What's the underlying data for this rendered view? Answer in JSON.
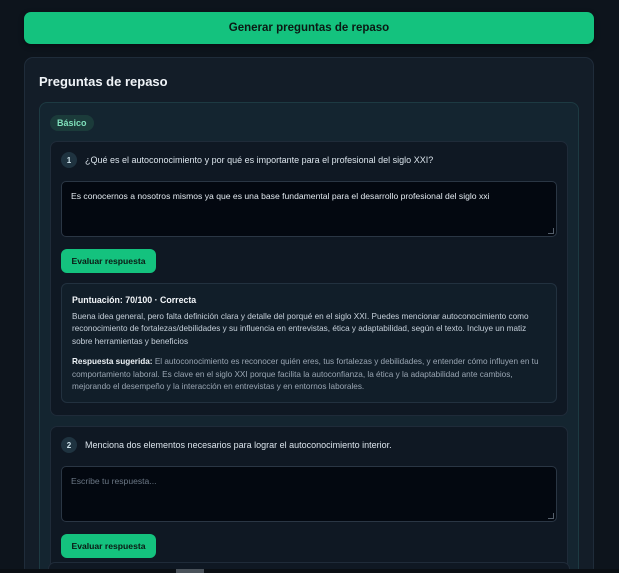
{
  "generate_button_label": "Generar preguntas de repaso",
  "review": {
    "title": "Preguntas de repaso",
    "level": "Básico",
    "questions": [
      {
        "number": "1",
        "text": "¿Qué es el autoconocimiento y por qué es importante para el profesional del siglo XXI?",
        "answer": "Es conocernos a nosotros mismos ya que es una base fundamental para el desarrollo profesional del siglo xxi",
        "eval_label": "Evaluar respuesta",
        "feedback": {
          "score": "Puntuación: 70/100 · Correcta",
          "text": "Buena idea general, pero falta definición clara y detalle del porqué en el siglo XXI. Puedes mencionar autoconocimiento como reconocimiento de fortalezas/debilidades y su influencia en entrevistas, ética y adaptabilidad, según el texto. Incluye un matiz sobre herramientas y beneficios",
          "suggested_label": "Respuesta sugerida:",
          "suggested_text": "El autoconocimiento es reconocer quién eres, tus fortalezas y debilidades, y entender cómo influyen en tu comportamiento laboral. Es clave en el siglo XXI porque facilita la autoconfianza, la ética y la adaptabilidad ante cambios, mejorando el desempeño y la interacción en entrevistas y en entornos laborales."
        }
      },
      {
        "number": "2",
        "text": "Menciona dos elementos necesarios para lograr el autoconocimiento interior.",
        "placeholder": "Escribe tu respuesta...",
        "eval_label": "Evaluar respuesta"
      }
    ]
  }
}
